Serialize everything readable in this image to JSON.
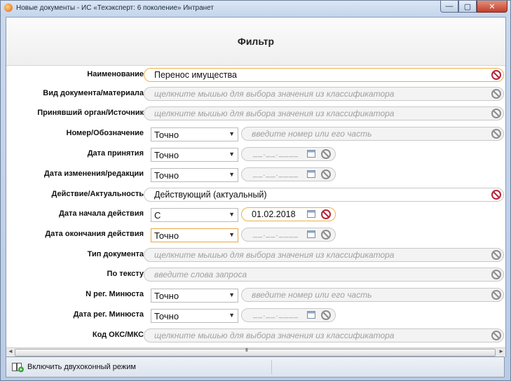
{
  "window": {
    "title": "Новые документы - ИС «Техэксперт: 6 поколение» Интранет"
  },
  "header": {
    "title": "Фильтр"
  },
  "rows": [
    {
      "label": "Наименование",
      "value": "Перенос имущества"
    },
    {
      "label": "Вид документа/материала",
      "placeholder": "щелкните мышью для выбора значения из классификатора"
    },
    {
      "label": "Принявший орган/Источник",
      "placeholder": "щелкните мышью для выбора значения из классификатора"
    },
    {
      "label": "Номер/Обозначение",
      "mode": "Точно",
      "placeholder": "введите номер или его часть"
    },
    {
      "label": "Дата принятия",
      "mode": "Точно",
      "date": "__.__.____"
    },
    {
      "label": "Дата изменения/редакции",
      "mode": "Точно",
      "date": "__.__.____"
    },
    {
      "label": "Действие/Актуальность",
      "value": "Действующий (актуальный)"
    },
    {
      "label": "Дата начала действия",
      "mode": "С",
      "date": "01.02.2018"
    },
    {
      "label": "Дата окончания действия",
      "mode": "Точно",
      "date": "__.__.____"
    },
    {
      "label": "Тип документа",
      "placeholder": "щелкните мышью для выбора значения из классификатора"
    },
    {
      "label": "По тексту",
      "placeholder": "введите слова запроса"
    },
    {
      "label": "N рег. Минюста",
      "mode": "Точно",
      "placeholder": "введите номер или его часть"
    },
    {
      "label": "Дата рег. Минюста",
      "mode": "Точно",
      "date": "__.__.____"
    },
    {
      "label": "Код ОКС/МКС",
      "placeholder": "щелкните мышью для выбора значения из классификатора"
    }
  ],
  "statusbar": {
    "dual_window_label": "Включить двухоконный режим"
  },
  "window_buttons": {
    "minimize": "—",
    "maximize": "▢",
    "close": "✕"
  },
  "scroll": {
    "grip": "III"
  },
  "colors": {
    "clear_icon": "#b3223a",
    "active_border": "#e9b24a"
  }
}
